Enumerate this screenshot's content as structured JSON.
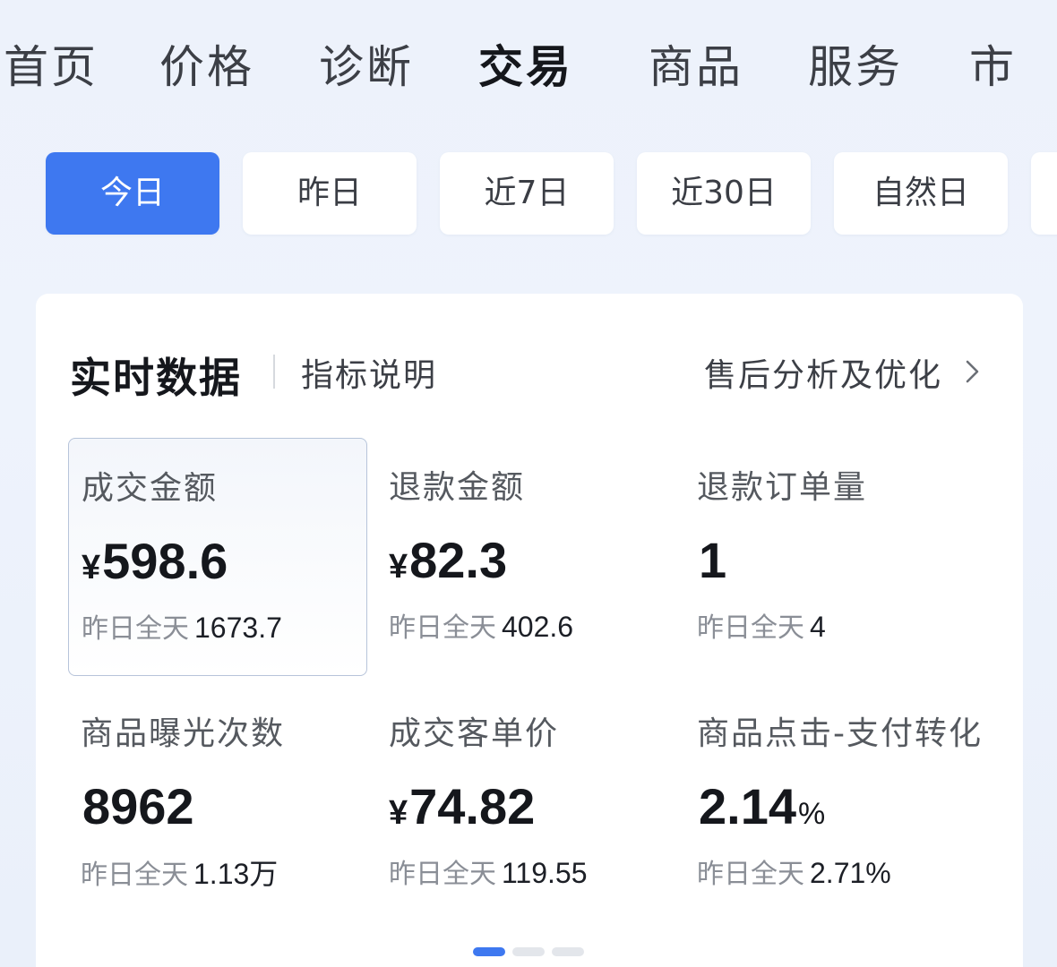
{
  "nav": {
    "items": [
      "首页",
      "价格",
      "诊断",
      "交易",
      "商品",
      "服务",
      "市"
    ],
    "active": "交易"
  },
  "date_filters": {
    "items": [
      "今日",
      "昨日",
      "近7日",
      "近30日",
      "自然日"
    ],
    "active": "今日"
  },
  "card": {
    "title": "实时数据",
    "metric_help": "指标说明",
    "aftersale_link": "售后分析及优化",
    "prev_label": "昨日全天",
    "metrics": [
      {
        "label": "成交金额",
        "prefix": "¥",
        "value": "598.6",
        "suffix": "",
        "prev": "1673.7",
        "selected": true
      },
      {
        "label": "退款金额",
        "prefix": "¥",
        "value": "82.3",
        "suffix": "",
        "prev": "402.6"
      },
      {
        "label": "退款订单量",
        "prefix": "",
        "value": "1",
        "suffix": "",
        "prev": "4"
      },
      {
        "label": "商品曝光次数",
        "prefix": "",
        "value": "8962",
        "suffix": "",
        "prev": "1.13万"
      },
      {
        "label": "成交客单价",
        "prefix": "¥",
        "value": "74.82",
        "suffix": "",
        "prev": "119.55"
      },
      {
        "label": "商品点击-支付转化",
        "prefix": "",
        "value": "2.14",
        "suffix": "%",
        "prev": "2.71%"
      }
    ]
  },
  "pagination": {
    "pages": 3,
    "current": 1
  },
  "colors": {
    "accent": "#3e78f0",
    "text_primary": "#15171c",
    "text_secondary": "#8a8e96"
  }
}
